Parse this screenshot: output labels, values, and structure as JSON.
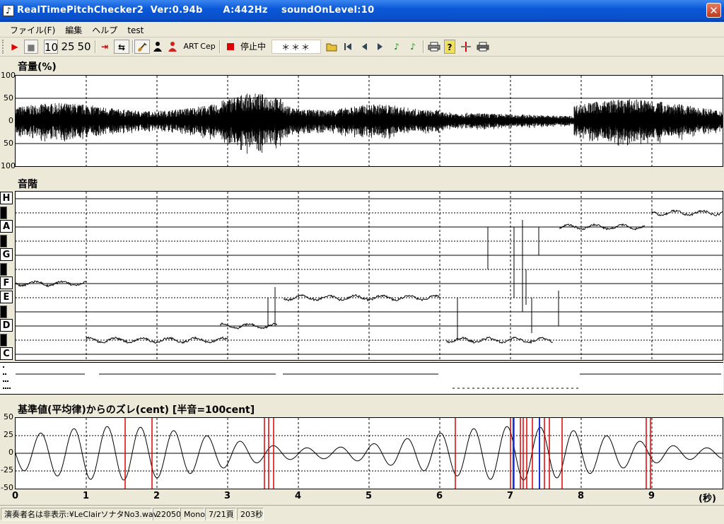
{
  "window": {
    "title": "RealTimePitchChecker2  Ver:0.94b      A:442Hz    soundOnLevel:10",
    "icon": "music-note-icon",
    "close_glyph": "✕"
  },
  "menu": {
    "items": [
      "ファイル(F)",
      "編集",
      "ヘルプ",
      "test"
    ]
  },
  "toolbar": {
    "play_icon": "▶",
    "stop_icon": "■",
    "speed_10": "10",
    "speed_25": "25",
    "speed_50": "50",
    "to_end_icon": "⇥",
    "loop_icon": "⇆",
    "art_label": "ART",
    "cep_label": "Cep",
    "status_text": "停止中",
    "display_text": "＊＊＊",
    "help_icon": "?",
    "accent": "#e00000"
  },
  "volume": {
    "title": "音量(%)",
    "y_ticks": [
      "100",
      "50",
      "0",
      "50",
      "100"
    ]
  },
  "scale": {
    "title": "音階",
    "notes": [
      "H",
      "A",
      "G",
      "F",
      "E",
      "D",
      "C"
    ]
  },
  "deviation": {
    "title": "基準値(平均律)からのズレ(cent) [半音=100cent]",
    "y_ticks": [
      "50",
      "25",
      "0",
      "-25",
      "-50"
    ]
  },
  "x_axis": {
    "ticks": [
      "0",
      "1",
      "2",
      "3",
      "4",
      "5",
      "6",
      "7",
      "8",
      "9"
    ],
    "unit": "(秒)"
  },
  "status": {
    "file": "演奏者名は非表示:¥LeClairソナタNo3.wav",
    "rate": "22050",
    "channels": "Mono",
    "page": "7/21頁",
    "duration": "203秒"
  }
}
